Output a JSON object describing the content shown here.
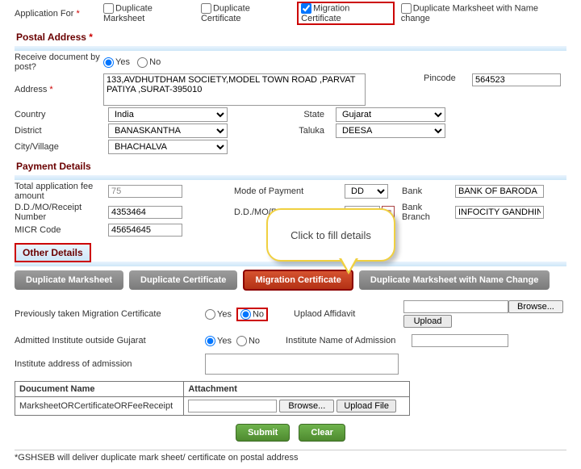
{
  "appfor": {
    "label": "Application For",
    "opt1": "Duplicate Marksheet",
    "opt2": "Duplicate Certificate",
    "opt3": "Migration Certificate",
    "opt4": "Duplicate Marksheet with Name change"
  },
  "postal": {
    "header": "Postal Address",
    "recv_label": "Receive document by post?",
    "yes": "Yes",
    "no": "No",
    "addr_label": "Address",
    "addr_val": "133,AVDHUTDHAM SOCIETY,MODEL TOWN ROAD ,PARVAT PATIYA ,SURAT-395010",
    "pin_label": "Pincode",
    "pin_val": "564523",
    "country_label": "Country",
    "country_val": "India",
    "state_label": "State",
    "state_val": "Gujarat",
    "district_label": "District",
    "district_val": "BANASKANTHA",
    "taluka_label": "Taluka",
    "taluka_val": "DEESA",
    "city_label": "City/Village",
    "city_val": "BHACHALVA"
  },
  "pay": {
    "header": "Payment Details",
    "total_label": "Total application fee amount",
    "total_val": "75",
    "mode_label": "Mode of Payment",
    "mode_val": "DD",
    "bank_label": "Bank",
    "bank_val": "BANK OF BARODA",
    "ddno_label": "D.D./MO/Receipt Number",
    "ddno_val": "4353464",
    "dddate_label": "D.D./MO/Receipt Date",
    "dddate_val": "",
    "branch_label": "Bank Branch",
    "branch_val": "INFOCITY GANDHINAGAR",
    "micr_label": "MICR Code",
    "micr_val": "45654645"
  },
  "other": {
    "header": "Other Details",
    "tab1": "Duplicate Marksheet",
    "tab2": "Duplicate Certificate",
    "tab3": "Migration Certificate",
    "tab4": "Duplicate Marksheet with Name Change",
    "prev_label": "Previously taken Migration Certificate",
    "yes": "Yes",
    "no": "No",
    "aff_label": "Uplaod Affidavit",
    "browse": "Browse...",
    "upload": "Upload",
    "adm_label": "Admitted Institute outside Gujarat",
    "instname_label": "Institute Name of Admission",
    "instaddr_label": "Institute address of admission",
    "doc_col1": "Doucument Name",
    "doc_col2": "Attachment",
    "doc_row1": "MarksheetORCertificateORFeeReceipt",
    "uploadfile": "Upload File"
  },
  "callout": "Click to fill details",
  "submit": "Submit",
  "clear": "Clear",
  "footer": "*GSHSEB will deliver duplicate mark sheet/ certificate on postal address"
}
